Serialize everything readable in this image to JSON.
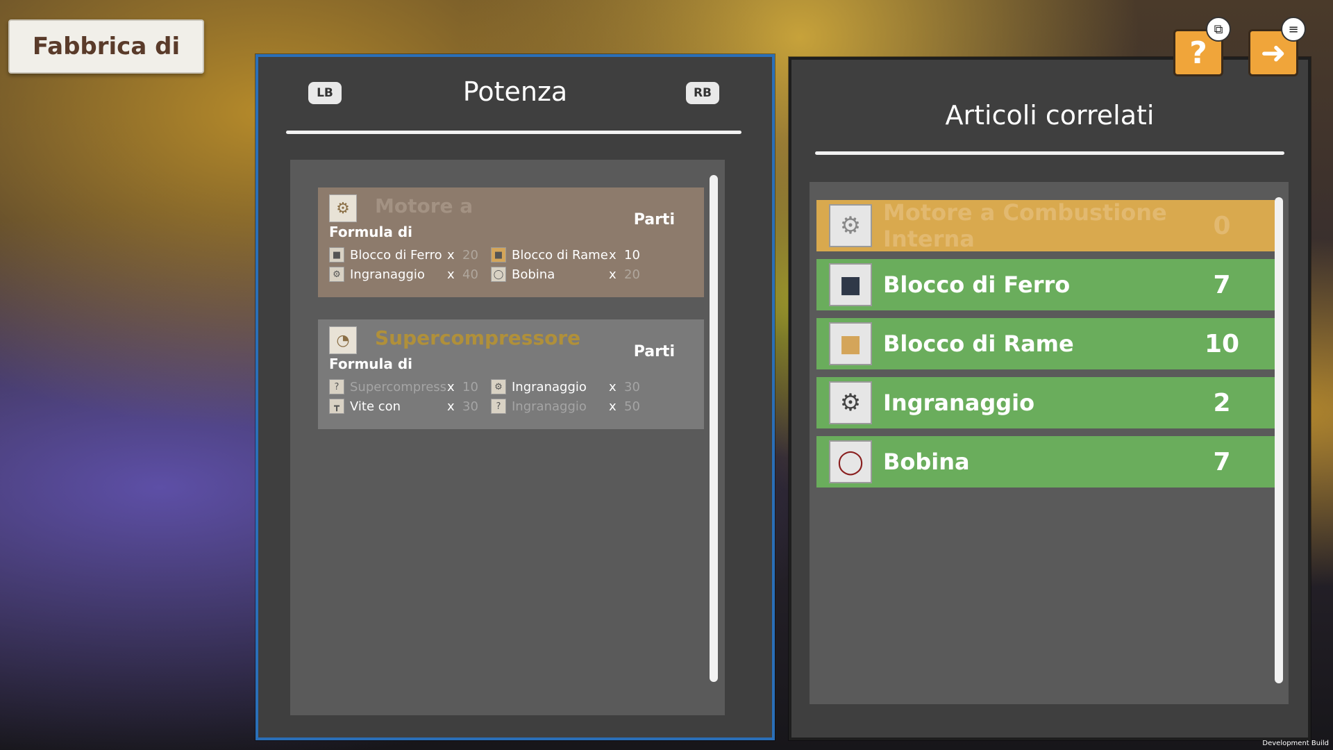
{
  "title_tab": "Fabbrica di",
  "left_panel": {
    "lb": "LB",
    "rb": "RB",
    "title": "Potenza",
    "cards": [
      {
        "name": "Motore a",
        "formula": "Formula di",
        "parti": "Parti",
        "icon": "engine-icon",
        "ingredients": [
          {
            "name": "Blocco di Ferro",
            "x": "x",
            "qty": "20",
            "icon": "iron-block-icon"
          },
          {
            "name": "Blocco di Rame",
            "x": "x",
            "qty": "10",
            "icon": "copper-block-icon"
          },
          {
            "name": "Ingranaggio",
            "x": "x",
            "qty": "40",
            "icon": "gear-icon"
          },
          {
            "name": "Bobina",
            "x": "x",
            "qty": "20",
            "icon": "coil-icon"
          }
        ]
      },
      {
        "name": "Supercompressore",
        "formula": "Formula di",
        "parti": "Parti",
        "icon": "gauge-icon",
        "ingredients": [
          {
            "name": "Supercompressore",
            "x": "x",
            "qty": "10",
            "icon": "unknown-icon"
          },
          {
            "name": "Ingranaggio",
            "x": "x",
            "qty": "30",
            "icon": "gear-icon"
          },
          {
            "name": "Vite con",
            "x": "x",
            "qty": "30",
            "icon": "screw-icon"
          },
          {
            "name": "Ingranaggio",
            "x": "x",
            "qty": "50",
            "icon": "unknown-icon"
          }
        ]
      }
    ]
  },
  "right_panel": {
    "title": "Articoli correlati",
    "items": [
      {
        "name": "Motore a Combustione Interna",
        "count": "0",
        "icon": "engine-icon",
        "color": "#d9a94e"
      },
      {
        "name": "Blocco di Ferro",
        "count": "7",
        "icon": "iron-block-icon",
        "color": "#6aad5c"
      },
      {
        "name": "Blocco di Rame",
        "count": "10",
        "icon": "copper-block-icon",
        "color": "#6aad5c"
      },
      {
        "name": "Ingranaggio",
        "count": "2",
        "icon": "gear-icon",
        "color": "#6aad5c"
      },
      {
        "name": "Bobina",
        "count": "7",
        "icon": "coil-icon",
        "color": "#6aad5c"
      }
    ]
  },
  "buttons": {
    "help": "?",
    "exit_icon": "exit-icon",
    "help_badge_icon": "window-icon",
    "exit_badge_icon": "menu-icon"
  },
  "footer": "Development Build"
}
